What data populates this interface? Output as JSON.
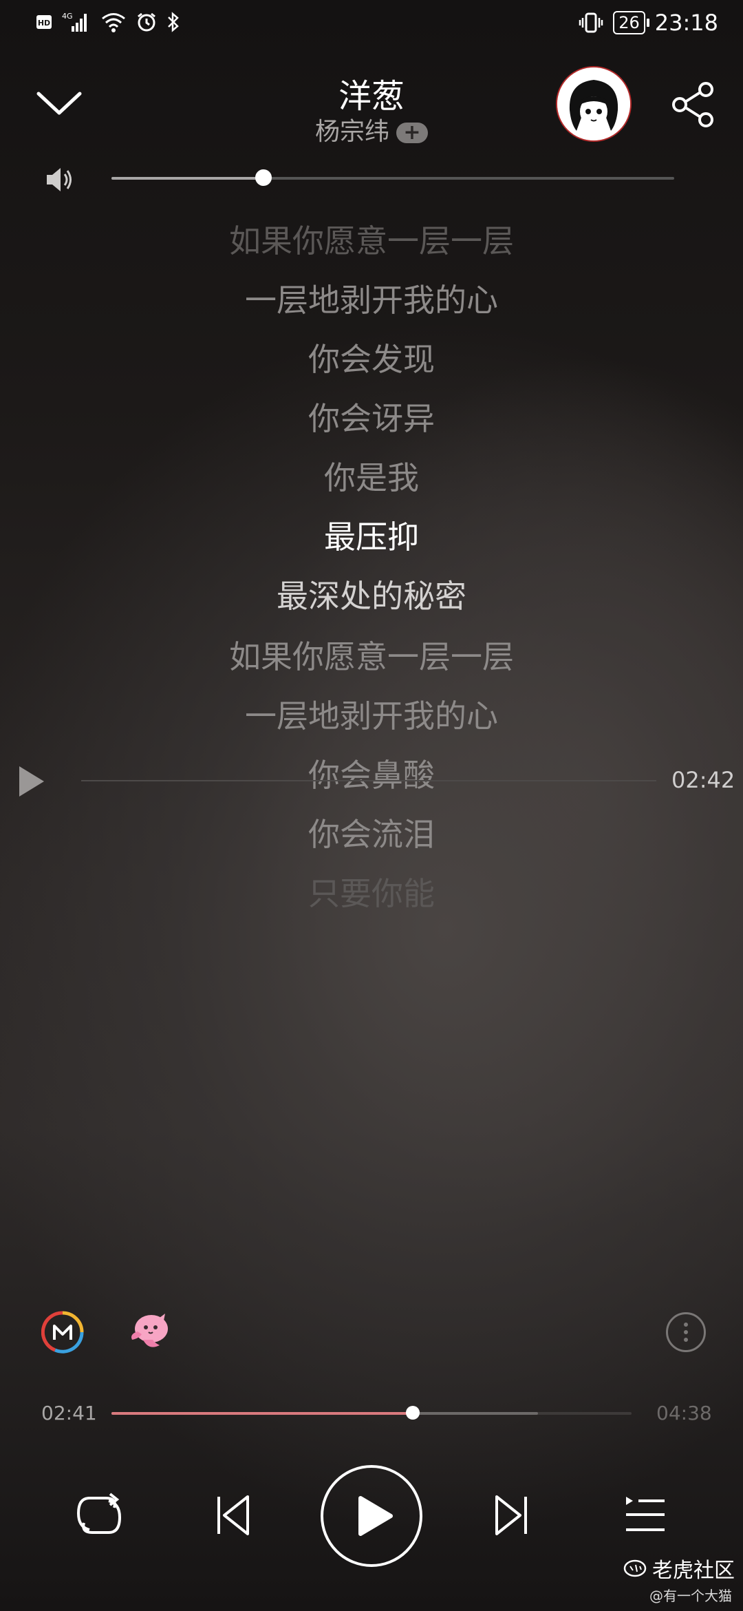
{
  "status_bar": {
    "time": "23:18",
    "battery": "26",
    "network": "4G",
    "hd": "HD",
    "icons": [
      "hd-icon",
      "signal-icon",
      "wifi-icon",
      "alarm-icon",
      "bluetooth-icon",
      "vibrate-icon",
      "battery-icon"
    ]
  },
  "song": {
    "title": "洋葱",
    "artist": "杨宗纬",
    "follow": "+"
  },
  "volume": {
    "level": 0.27
  },
  "lyrics": [
    "如果你愿意一层一层",
    "一层地剥开我的心",
    "你会发现",
    "你会讶异",
    "你是我",
    "最压抑",
    "最深处的秘密",
    "如果你愿意一层一层",
    "一层地剥开我的心",
    "你会鼻酸",
    "你会流泪",
    "只要你能"
  ],
  "active_lyric_index": 5,
  "seek_time": "02:42",
  "progress": {
    "current": "02:41",
    "total": "04:38",
    "played_fraction": 0.58,
    "buffered_fraction": 0.82
  },
  "controls": [
    "repeat-icon",
    "previous-icon",
    "play-icon",
    "next-icon",
    "playlist-icon"
  ],
  "watermark": {
    "brand": "老虎社区",
    "user": "@有一个大猫"
  },
  "colors": {
    "accent": "#d97a7e",
    "avatar_ring": "#b32a2a"
  }
}
